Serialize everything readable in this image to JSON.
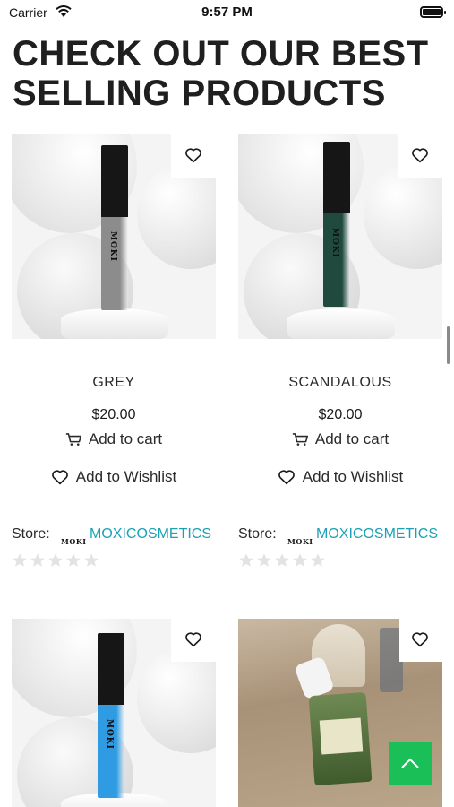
{
  "status_bar": {
    "carrier": "Carrier",
    "time": "9:57 PM"
  },
  "section": {
    "title": "CHECK OUT OUR BEST SELLING PRODUCTS"
  },
  "products": [
    {
      "name": "GREY",
      "price": "$20.00",
      "add_to_cart": "Add to cart",
      "add_to_wishlist": "Add to Wishlist",
      "store_label": "Store:",
      "store_logo": "MOKI",
      "store_name": "MOXICOSMETICS",
      "rating_stars": 0,
      "tube_color": "#8c8c8c",
      "brand_text": "MOKI"
    },
    {
      "name": "SCANDALOUS",
      "price": "$20.00",
      "add_to_cart": "Add to cart",
      "add_to_wishlist": "Add to Wishlist",
      "store_label": "Store:",
      "store_logo": "MOKI",
      "store_name": "MOXICOSMETICS",
      "rating_stars": 0,
      "tube_color": "#1f4a3d",
      "brand_text": "MOKI"
    },
    {
      "tube_color": "#2f9be3",
      "brand_text": "MOKI"
    },
    {
      "image": "photo"
    }
  ],
  "colors": {
    "accent_link": "#1ba1b5",
    "scroll_top_button": "#1bbf57"
  },
  "icons": {
    "wifi": "wifi-icon",
    "battery": "battery-icon",
    "wishlist_heart": "heart-outline-icon",
    "cart": "cart-icon",
    "star": "star-icon",
    "scroll_top": "chevron-up-icon"
  }
}
